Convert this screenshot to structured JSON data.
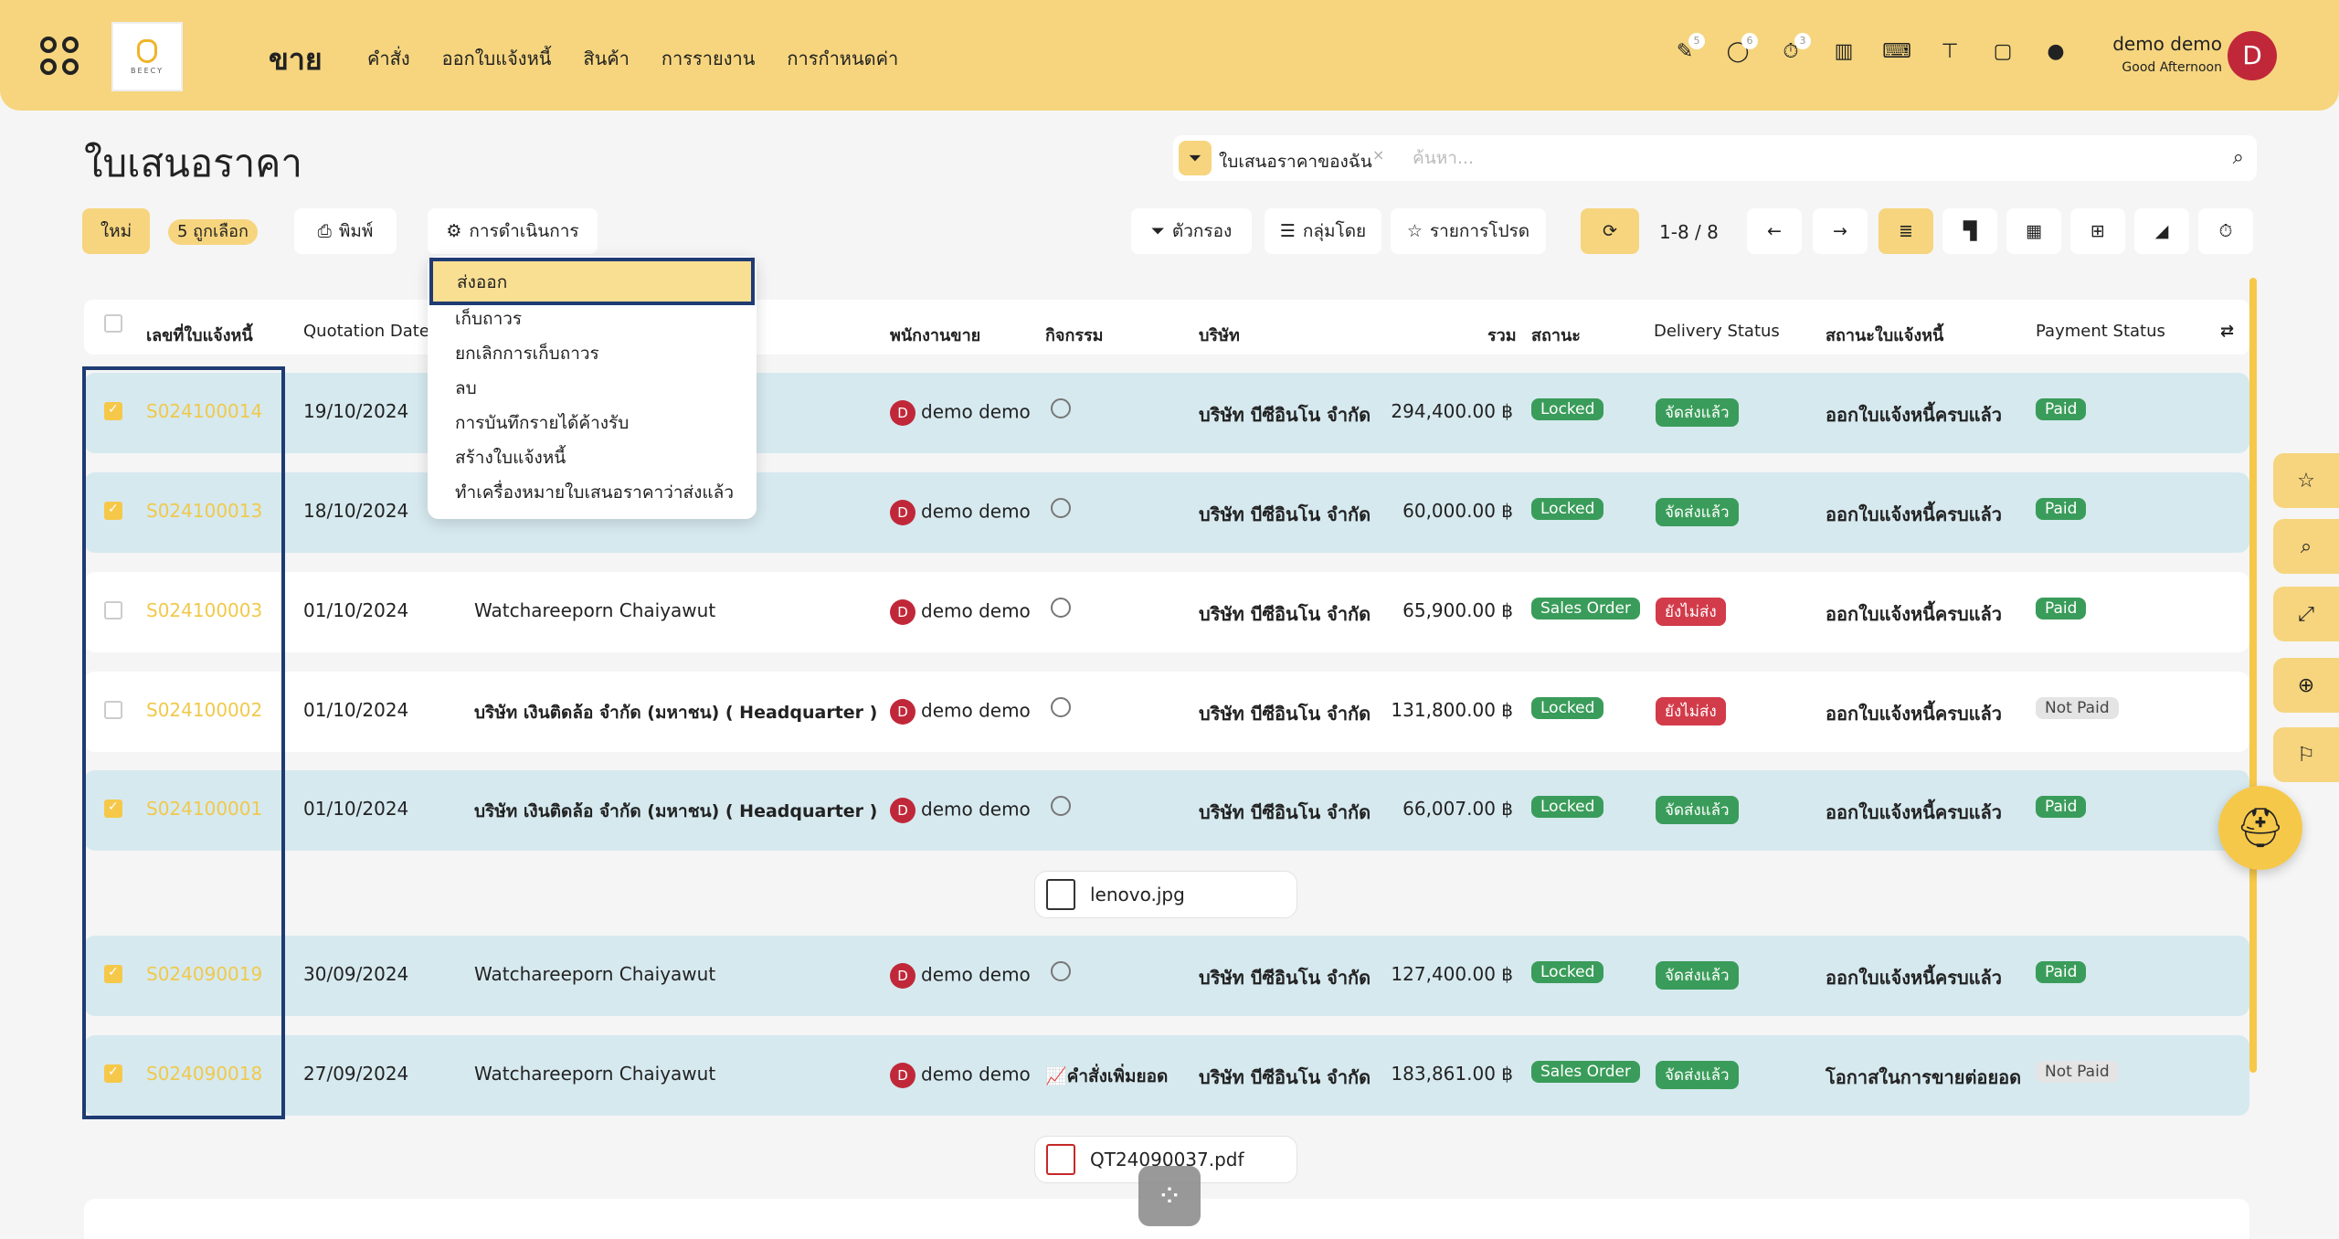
{
  "header": {
    "module": "ขาย",
    "nav": [
      "คำสั่ง",
      "ออกใบแจ้งหนี้",
      "สินค้า",
      "การรายงาน",
      "การกำหนดค่า"
    ],
    "logo_text": "BEECY",
    "badges": {
      "activity": "5",
      "chat": "6",
      "timer": "3"
    },
    "user_name": "demo demo",
    "greeting": "Good Afternoon",
    "avatar_initial": "D"
  },
  "page": {
    "title": "ใบเสนอราคา",
    "filter_chip": "ใบเสนอราคาของฉัน",
    "search_placeholder": "ค้นหา...",
    "new_label": "ใหม่",
    "selected_label": "5 ถูกเลือก",
    "print_label": "พิมพ์",
    "action_label": "การดำเนินการ",
    "filter_label": "ตัวกรอง",
    "group_label": "กลุ่มโดย",
    "favorite_label": "รายการโปรด",
    "pager": "1-8 / 8"
  },
  "action_menu": [
    "ส่งออก",
    "เก็บถาวร",
    "ยกเลิกการเก็บถาวร",
    "ลบ",
    "การบันทึกรายได้ค้างรับ",
    "สร้างใบแจ้งหนี้",
    "ทำเครื่องหมายใบเสนอราคาว่าส่งแล้ว"
  ],
  "columns": {
    "number": "เลขที่ใบแจ้งหนี้",
    "date": "Quotation Date",
    "salesperson": "พนักงานขาย",
    "activity": "กิจกรรม",
    "company": "บริษัท",
    "total": "รวม",
    "status": "สถานะ",
    "delivery": "Delivery Status",
    "invoice_status": "สถานะใบแจ้งหนี้",
    "payment": "Payment Status"
  },
  "rows": [
    {
      "number": "S024100014",
      "date": "19/10/2024",
      "customer": "",
      "salesperson": "demo demo",
      "activity": "",
      "company": "บริษัท บีซีอินโน จำกัด",
      "total": "294,400.00 ฿",
      "status": "Locked",
      "delivery": "จัดส่งแล้ว",
      "invoice_status": "ออกใบแจ้งหนี้ครบแล้ว",
      "payment": "Paid"
    },
    {
      "number": "S024100013",
      "date": "18/10/2024",
      "customer": "",
      "salesperson": "demo demo",
      "activity": "",
      "company": "บริษัท บีซีอินโน จำกัด",
      "total": "60,000.00 ฿",
      "status": "Locked",
      "delivery": "จัดส่งแล้ว",
      "invoice_status": "ออกใบแจ้งหนี้ครบแล้ว",
      "payment": "Paid"
    },
    {
      "number": "S024100003",
      "date": "01/10/2024",
      "customer": "Watchareeporn Chaiyawut",
      "salesperson": "demo demo",
      "activity": "",
      "company": "บริษัท บีซีอินโน จำกัด",
      "total": "65,900.00 ฿",
      "status": "Sales Order",
      "delivery": "ยังไม่ส่ง",
      "invoice_status": "ออกใบแจ้งหนี้ครบแล้ว",
      "payment": "Paid"
    },
    {
      "number": "S024100002",
      "date": "01/10/2024",
      "customer": "บริษัท เงินติดล้อ จำกัด (มหาชน) ( Headquarter )",
      "salesperson": "demo demo",
      "activity": "",
      "company": "บริษัท บีซีอินโน จำกัด",
      "total": "131,800.00 ฿",
      "status": "Locked",
      "delivery": "ยังไม่ส่ง",
      "invoice_status": "ออกใบแจ้งหนี้ครบแล้ว",
      "payment": "Not Paid"
    },
    {
      "number": "S024100001",
      "date": "01/10/2024",
      "customer": "บริษัท เงินติดล้อ จำกัด (มหาชน) ( Headquarter )",
      "salesperson": "demo demo",
      "activity": "",
      "company": "บริษัท บีซีอินโน จำกัด",
      "total": "66,007.00 ฿",
      "status": "Locked",
      "delivery": "จัดส่งแล้ว",
      "invoice_status": "ออกใบแจ้งหนี้ครบแล้ว",
      "payment": "Paid"
    },
    {
      "number": "S024090019",
      "date": "30/09/2024",
      "customer": "Watchareeporn Chaiyawut",
      "salesperson": "demo demo",
      "activity": "",
      "company": "บริษัท บีซีอินโน จำกัด",
      "total": "127,400.00 ฿",
      "status": "Locked",
      "delivery": "จัดส่งแล้ว",
      "invoice_status": "ออกใบแจ้งหนี้ครบแล้ว",
      "payment": "Paid"
    },
    {
      "number": "S024090018",
      "date": "27/09/2024",
      "customer": "Watchareeporn Chaiyawut",
      "salesperson": "demo demo",
      "activity": "คำสั่งเพิ่มยอด",
      "company": "บริษัท บีซีอินโน จำกัด",
      "total": "183,861.00 ฿",
      "status": "Sales Order",
      "delivery": "จัดส่งแล้ว",
      "invoice_status": "โอกาสในการขายต่อยอด",
      "payment": "Not Paid"
    }
  ],
  "attachments": [
    "lenovo.jpg",
    "QT24090037.pdf"
  ],
  "colors": {
    "accent": "#f6d57e",
    "locked": "#3a9c5a",
    "not_sent": "#d23b4a",
    "outline": "#1f3b73"
  }
}
